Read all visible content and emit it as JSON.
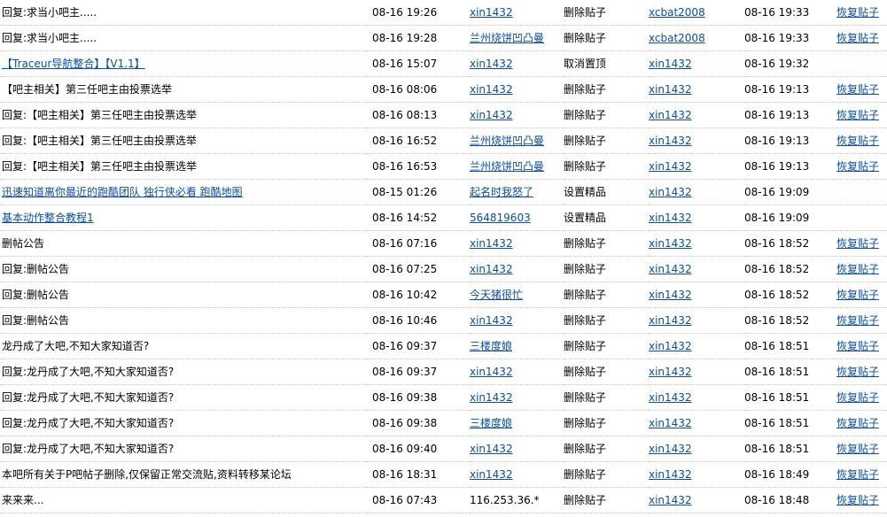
{
  "rows": [
    {
      "title": "回复:求当小吧主.....",
      "title_link": false,
      "post_time": "08-16 19:26",
      "author": "xin1432",
      "author_link": true,
      "action": "删除贴子",
      "operator": "xcbat2008",
      "op_time": "08-16 19:33",
      "restore": "恢复贴子"
    },
    {
      "title": "回复:求当小吧主.....",
      "title_link": false,
      "post_time": "08-16 19:28",
      "author": "兰州烧饼凹凸曼",
      "author_link": true,
      "action": "删除贴子",
      "operator": "xcbat2008",
      "op_time": "08-16 19:33",
      "restore": "恢复贴子"
    },
    {
      "title": "【Traceur导航整合】【V1.1】",
      "title_link": true,
      "post_time": "08-16 15:07",
      "author": "xin1432",
      "author_link": true,
      "action": "取消置顶",
      "operator": "xin1432",
      "op_time": "08-16 19:32",
      "restore": ""
    },
    {
      "title": "【吧主相关】第三任吧主由投票选举",
      "title_link": false,
      "post_time": "08-16 08:06",
      "author": "xin1432",
      "author_link": true,
      "action": "删除贴子",
      "operator": "xin1432",
      "op_time": "08-16 19:13",
      "restore": "恢复贴子"
    },
    {
      "title": "回复:【吧主相关】第三任吧主由投票选举",
      "title_link": false,
      "post_time": "08-16 08:13",
      "author": "xin1432",
      "author_link": true,
      "action": "删除贴子",
      "operator": "xin1432",
      "op_time": "08-16 19:13",
      "restore": "恢复贴子"
    },
    {
      "title": "回复:【吧主相关】第三任吧主由投票选举",
      "title_link": false,
      "post_time": "08-16 16:52",
      "author": "兰州烧饼凹凸曼",
      "author_link": true,
      "action": "删除贴子",
      "operator": "xin1432",
      "op_time": "08-16 19:13",
      "restore": "恢复贴子"
    },
    {
      "title": "回复:【吧主相关】第三任吧主由投票选举",
      "title_link": false,
      "post_time": "08-16 16:53",
      "author": "兰州烧饼凹凸曼",
      "author_link": true,
      "action": "删除贴子",
      "operator": "xin1432",
      "op_time": "08-16 19:13",
      "restore": "恢复贴子"
    },
    {
      "title": "迅速知道离你最近的跑酷团队 独行侠必看 跑酷地图",
      "title_link": true,
      "post_time": "08-15 01:26",
      "author": "起名时我怒了",
      "author_link": true,
      "action": "设置精品",
      "operator": "xin1432",
      "op_time": "08-16 19:09",
      "restore": ""
    },
    {
      "title": "基本动作整合教程1",
      "title_link": true,
      "post_time": "08-16 14:52",
      "author": "564819603",
      "author_link": true,
      "action": "设置精品",
      "operator": "xin1432",
      "op_time": "08-16 19:09",
      "restore": ""
    },
    {
      "title": "删帖公告",
      "title_link": false,
      "post_time": "08-16 07:16",
      "author": "xin1432",
      "author_link": true,
      "action": "删除贴子",
      "operator": "xin1432",
      "op_time": "08-16 18:52",
      "restore": "恢复贴子"
    },
    {
      "title": "回复:删帖公告",
      "title_link": false,
      "post_time": "08-16 07:25",
      "author": "xin1432",
      "author_link": true,
      "action": "删除贴子",
      "operator": "xin1432",
      "op_time": "08-16 18:52",
      "restore": "恢复贴子"
    },
    {
      "title": "回复:删帖公告",
      "title_link": false,
      "post_time": "08-16 10:42",
      "author": "今天猪很忙",
      "author_link": true,
      "action": "删除贴子",
      "operator": "xin1432",
      "op_time": "08-16 18:52",
      "restore": "恢复贴子"
    },
    {
      "title": "回复:删帖公告",
      "title_link": false,
      "post_time": "08-16 10:46",
      "author": "xin1432",
      "author_link": true,
      "action": "删除贴子",
      "operator": "xin1432",
      "op_time": "08-16 18:52",
      "restore": "恢复贴子"
    },
    {
      "title": "龙丹成了大吧,不知大家知道否?",
      "title_link": false,
      "post_time": "08-16 09:37",
      "author": "三楼度娘",
      "author_link": true,
      "action": "删除贴子",
      "operator": "xin1432",
      "op_time": "08-16 18:51",
      "restore": "恢复贴子"
    },
    {
      "title": "回复:龙丹成了大吧,不知大家知道否?",
      "title_link": false,
      "post_time": "08-16 09:37",
      "author": "xin1432",
      "author_link": true,
      "action": "删除贴子",
      "operator": "xin1432",
      "op_time": "08-16 18:51",
      "restore": "恢复贴子"
    },
    {
      "title": "回复:龙丹成了大吧,不知大家知道否?",
      "title_link": false,
      "post_time": "08-16 09:38",
      "author": "xin1432",
      "author_link": true,
      "action": "删除贴子",
      "operator": "xin1432",
      "op_time": "08-16 18:51",
      "restore": "恢复贴子"
    },
    {
      "title": "回复:龙丹成了大吧,不知大家知道否?",
      "title_link": false,
      "post_time": "08-16 09:38",
      "author": "三楼度娘",
      "author_link": true,
      "action": "删除贴子",
      "operator": "xin1432",
      "op_time": "08-16 18:51",
      "restore": "恢复贴子"
    },
    {
      "title": "回复:龙丹成了大吧,不知大家知道否?",
      "title_link": false,
      "post_time": "08-16 09:40",
      "author": "xin1432",
      "author_link": true,
      "action": "删除贴子",
      "operator": "xin1432",
      "op_time": "08-16 18:51",
      "restore": "恢复贴子"
    },
    {
      "title": "本吧所有关于P吧帖子删除,仅保留正常交流贴,资料转移某论坛",
      "title_link": false,
      "post_time": "08-16 18:31",
      "author": "xin1432",
      "author_link": true,
      "action": "删除贴子",
      "operator": "xin1432",
      "op_time": "08-16 18:49",
      "restore": "恢复贴子"
    },
    {
      "title": "来来来...",
      "title_link": false,
      "post_time": "08-16 07:43",
      "author": "116.253.36.*",
      "author_link": false,
      "action": "删除贴子",
      "operator": "xin1432",
      "op_time": "08-16 18:48",
      "restore": "恢复贴子"
    }
  ]
}
